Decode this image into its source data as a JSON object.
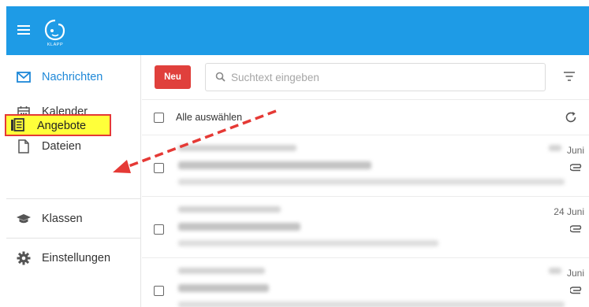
{
  "app": {
    "logo_text": "KLAPP"
  },
  "sidebar": {
    "items": [
      {
        "id": "nachrichten",
        "label": "Nachrichten",
        "icon": "mail-icon",
        "active": true
      },
      {
        "id": "kalender",
        "label": "Kalender",
        "icon": "calendar-icon"
      },
      {
        "id": "dateien",
        "label": "Dateien",
        "icon": "file-icon"
      },
      {
        "id": "angebote",
        "label": "Angebote",
        "icon": "offers-icon",
        "highlighted": true
      },
      {
        "id": "klassen",
        "label": "Klassen",
        "icon": "graduation-cap-icon"
      },
      {
        "id": "einstellungen",
        "label": "Einstellungen",
        "icon": "gear-icon"
      }
    ]
  },
  "toolbar": {
    "new_label": "Neu",
    "search_placeholder": "Suchtext eingeben"
  },
  "list": {
    "select_all_label": "Alle auswählen",
    "messages": [
      {
        "date": "Juni"
      },
      {
        "date": "24 Juni"
      },
      {
        "date": "Juni"
      }
    ]
  },
  "colors": {
    "brand": "#1e9be6",
    "active_text": "#1e88d8",
    "new_button": "#e0403c",
    "highlight_fill": "#ffff3a",
    "highlight_border": "#e53935"
  }
}
